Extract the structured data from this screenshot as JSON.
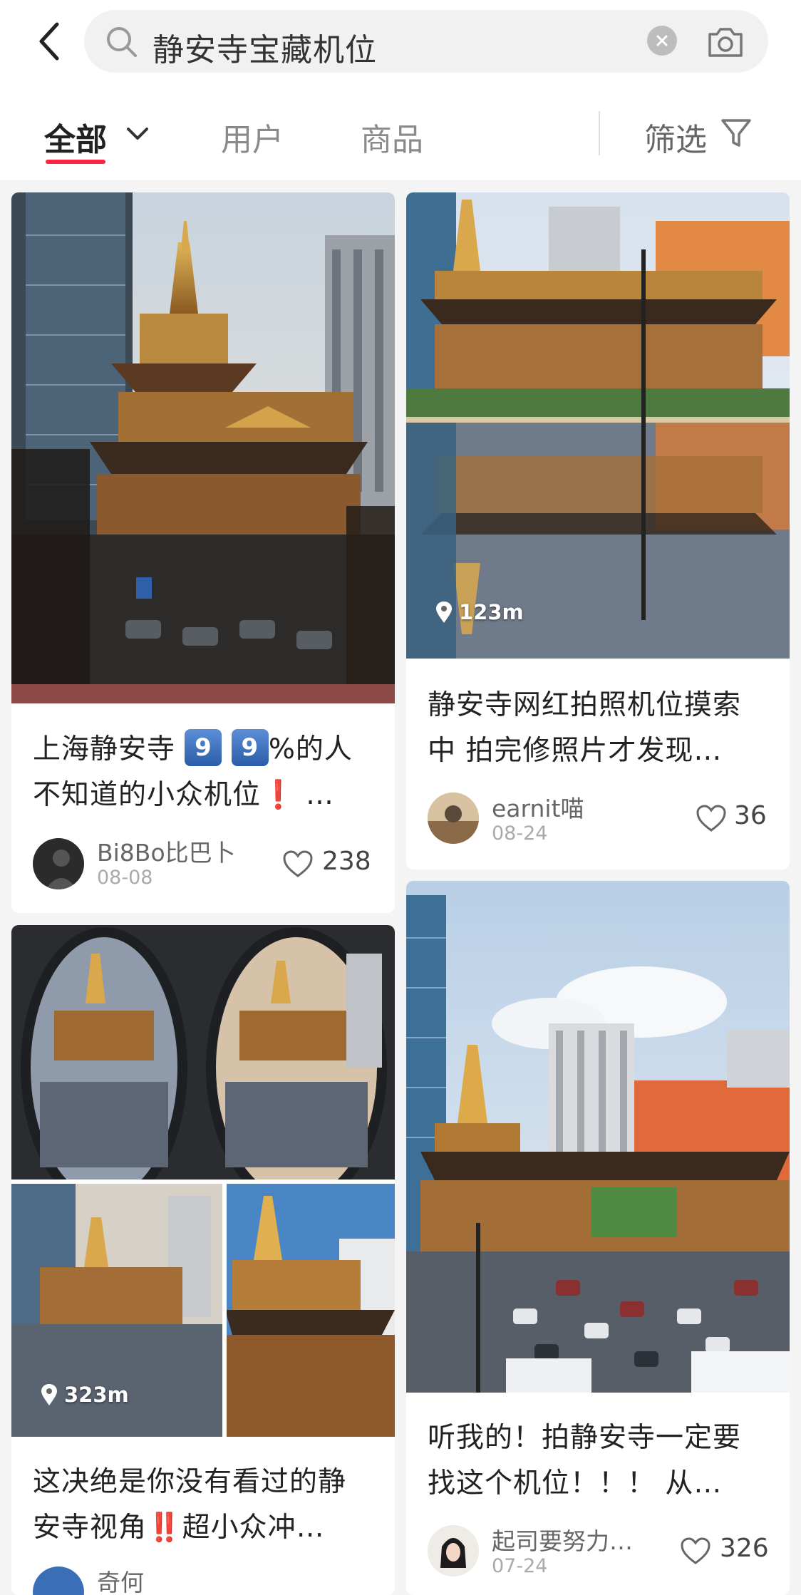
{
  "search": {
    "query": "静安寺宝藏机位"
  },
  "tabs": {
    "all": "全部",
    "users": "用户",
    "products": "商品",
    "filter": "筛选"
  },
  "posts": [
    {
      "title_a": "上海静安寺",
      "title_emoji1": "9",
      "title_emoji2": "9",
      "title_b": "%的人",
      "title_line2": "不知道的小众机位",
      "title_excl": "❗",
      "title_ellipsis": " …",
      "author": "Bi8Bo比巴卜",
      "date": "08-08",
      "likes": "238"
    },
    {
      "location": "123m",
      "title_line1": "静安寺网红拍照机位摸索",
      "title_line2": "中 拍完修照片才发现…",
      "author": "earnit喵",
      "date": "08-24",
      "likes": "36"
    },
    {
      "location": "323m",
      "title_line1": "这决绝是你没有看过的静",
      "title_line2a": "安寺视角",
      "title_excl": "‼️",
      "title_line2b": "超小众冲…",
      "author": "奇何"
    },
    {
      "title_line1": "听我的！拍静安寺一定要",
      "title_line2": "找这个机位！！！ 从…",
      "author": "起司要努力…",
      "date": "07-24",
      "likes": "326"
    }
  ],
  "colors": {
    "accent": "#ff2442",
    "background": "#f4f4f4"
  }
}
